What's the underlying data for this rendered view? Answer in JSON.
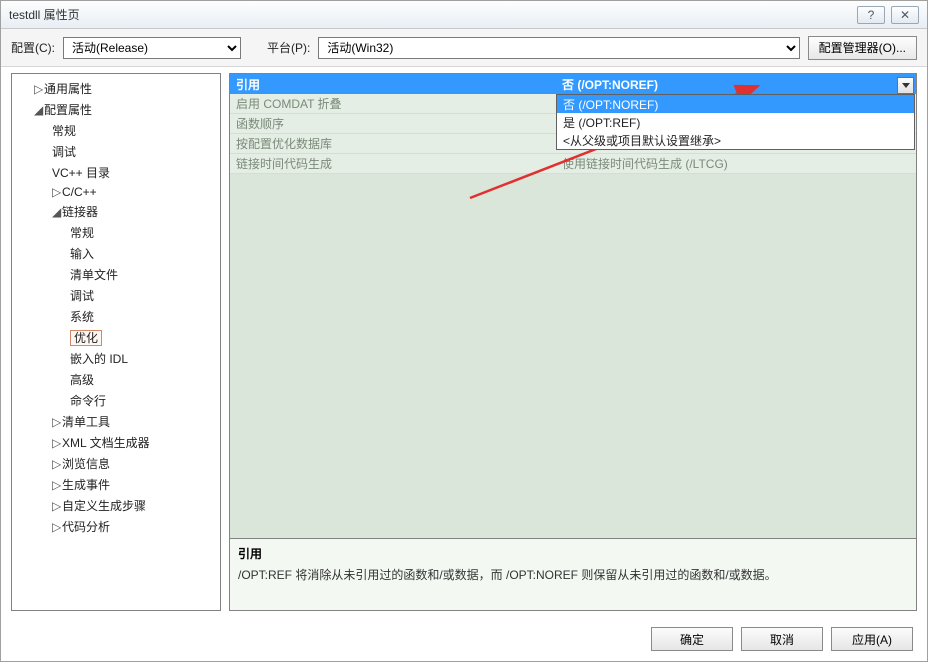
{
  "window": {
    "title": "testdll 属性页"
  },
  "toolbar": {
    "config_label": "配置(C):",
    "config_value": "活动(Release)",
    "platform_label": "平台(P):",
    "platform_value": "活动(Win32)",
    "config_mgr": "配置管理器(O)..."
  },
  "tree": {
    "common": "通用属性",
    "config_props": "配置属性",
    "general": "常规",
    "debug": "调试",
    "vcpp_dirs": "VC++ 目录",
    "ccpp": "C/C++",
    "linker": "链接器",
    "linker_general": "常规",
    "linker_input": "输入",
    "linker_manifest": "清单文件",
    "linker_debug": "调试",
    "linker_system": "系统",
    "linker_opt": "优化",
    "linker_idl": "嵌入的 IDL",
    "linker_advanced": "高级",
    "linker_cmdline": "命令行",
    "manifest_tool": "清单工具",
    "xml_docgen": "XML 文档生成器",
    "browse_info": "浏览信息",
    "build_events": "生成事件",
    "custom_build": "自定义生成步骤",
    "code_analysis": "代码分析"
  },
  "grid": {
    "rows": [
      {
        "name": "引用",
        "value": "否 (/OPT:NOREF)"
      },
      {
        "name": "启用 COMDAT 折叠",
        "value": ""
      },
      {
        "name": "函数顺序",
        "value": ""
      },
      {
        "name": "按配置优化数据库",
        "value": ""
      },
      {
        "name": "链接时间代码生成",
        "value": "使用链接时间代码生成 (/LTCG)"
      }
    ]
  },
  "dropdown": [
    "否 (/OPT:NOREF)",
    "是 (/OPT:REF)",
    "<从父级或项目默认设置继承>"
  ],
  "help": {
    "title": "引用",
    "text": "/OPT:REF 将消除从未引用过的函数和/或数据，而 /OPT:NOREF 则保留从未引用过的函数和/或数据。"
  },
  "buttons": {
    "ok": "确定",
    "cancel": "取消",
    "apply": "应用(A)"
  }
}
